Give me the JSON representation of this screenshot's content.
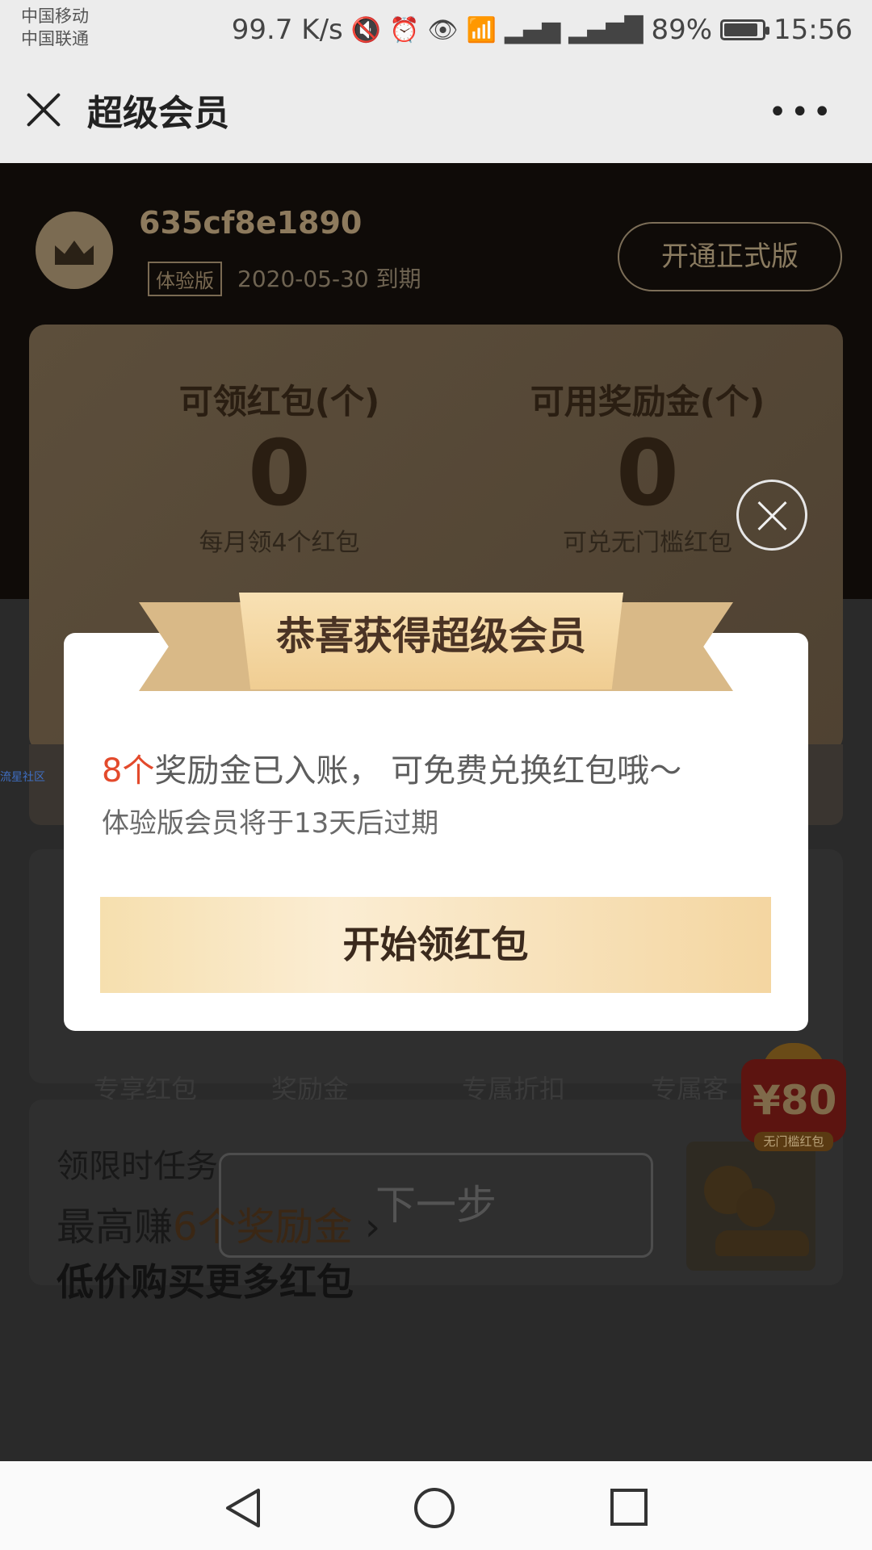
{
  "status_bar": {
    "carrier_1": "中国移动",
    "carrier_2": "中国联通",
    "speed": "99.7 K/s",
    "battery": "89%",
    "battery_level": 0.89,
    "time": "15:56",
    "icons": [
      "mute-icon",
      "alarm-icon",
      "eye-icon",
      "wifi-icon",
      "signal-2g-icon",
      "signal-4g-icon"
    ]
  },
  "titlebar": {
    "title": "超级会员"
  },
  "profile": {
    "username": "635cf8e1890",
    "badge": "体验版",
    "expiry": "2020-05-30 到期",
    "open_button": "开通正式版"
  },
  "stats": {
    "left": {
      "label": "可领红包(个)",
      "value": "0",
      "sub": "每月领4个红包"
    },
    "right": {
      "label": "可用奖励金(个)",
      "value": "0",
      "sub": "可兑无门槛红包"
    }
  },
  "side_tag": "流星社区",
  "benefits": [
    "专享红包",
    "奖励金",
    "专属折扣",
    "专属客"
  ],
  "tasks": {
    "title": "领限时任务",
    "line_prefix": "最高赚",
    "line_highlight": "6个奖励金",
    "arrow": "›"
  },
  "next_button": "下一步",
  "section_title": "低价购买更多红包",
  "redpack": {
    "amount": "¥80",
    "tag": "无门槛红包"
  },
  "modal": {
    "ribbon_title": "恭喜获得超级会员",
    "highlight": "8个",
    "message": "奖励金已入账， 可免费兑换红包哦～",
    "note": "体验版会员将于13天后过期",
    "cta": "开始领红包"
  },
  "colors": {
    "accent_gold": "#f0cd92",
    "highlight_red": "#e34a2c",
    "dark_bg": "#0f0b08"
  }
}
